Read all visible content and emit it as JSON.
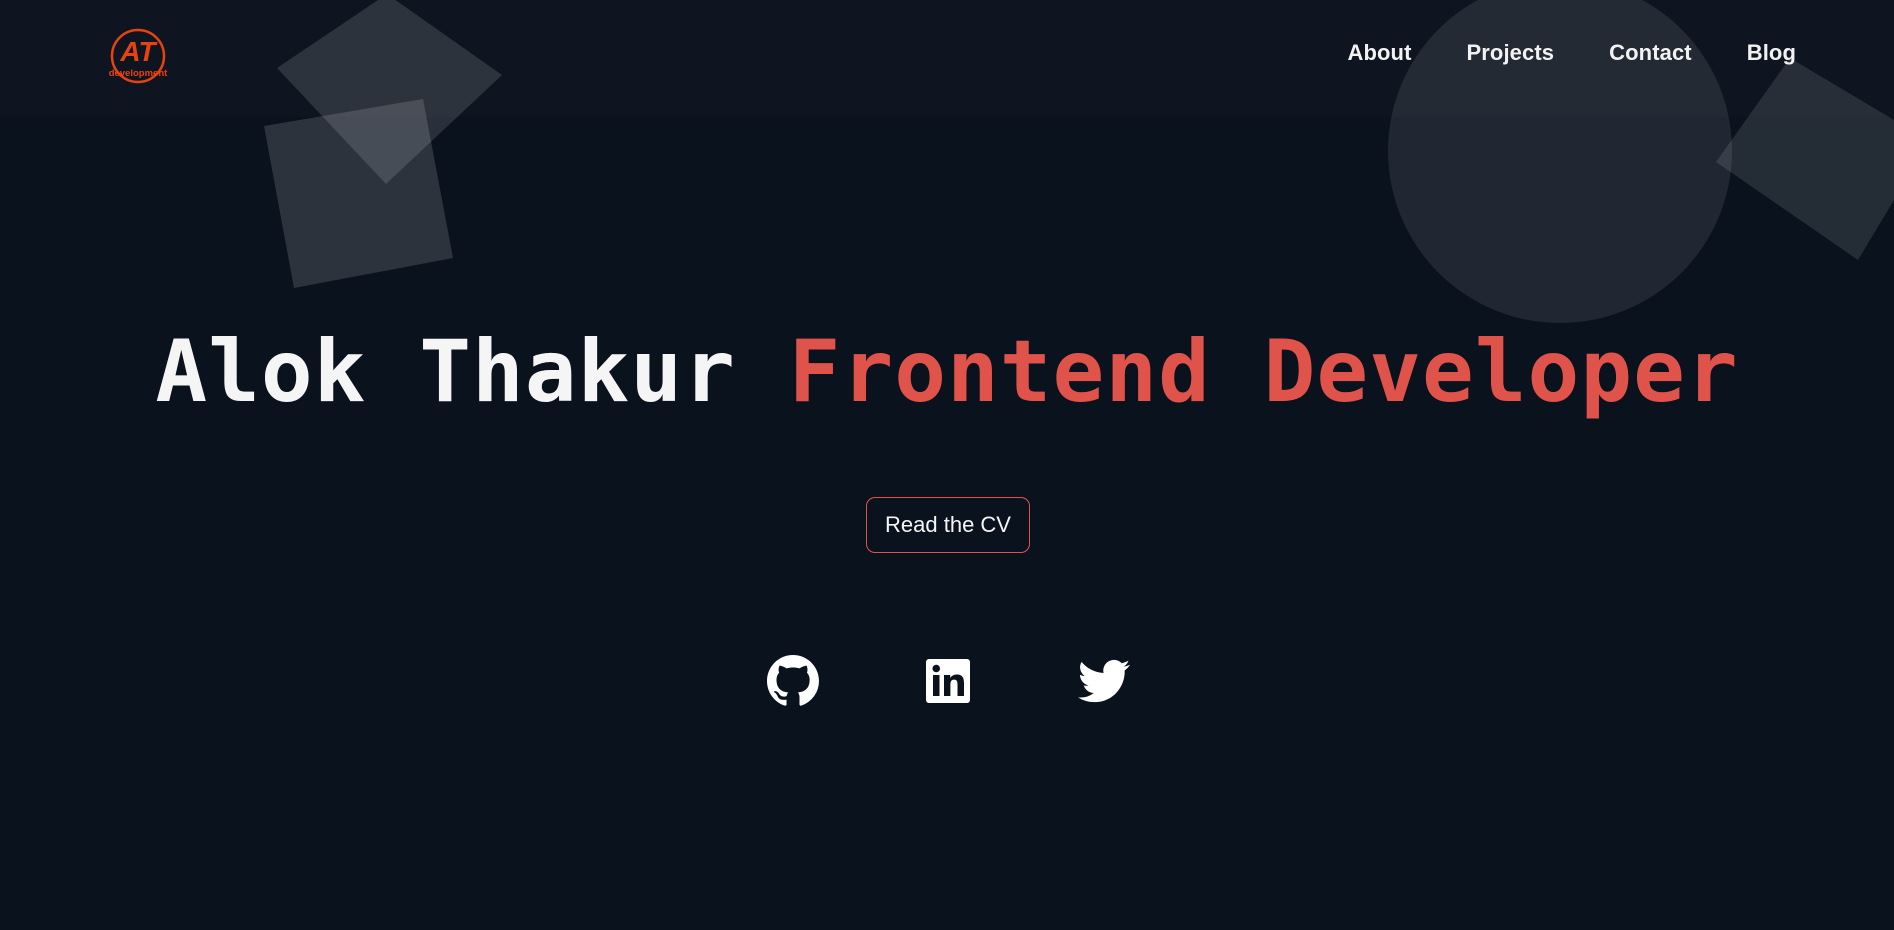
{
  "colors": {
    "background": "#0a121e",
    "accent": "#e0534a",
    "text": "#f5f5f5",
    "logo": "#e8420f"
  },
  "logo": {
    "mark": "AT",
    "subtitle": "development"
  },
  "nav": {
    "items": [
      "About",
      "Projects",
      "Contact",
      "Blog"
    ]
  },
  "hero": {
    "name": "Alok Thakur",
    "role": "Frontend Developer"
  },
  "cta": {
    "label": "Read the CV"
  },
  "social": {
    "icons": [
      "github-icon",
      "linkedin-icon",
      "twitter-icon"
    ]
  }
}
